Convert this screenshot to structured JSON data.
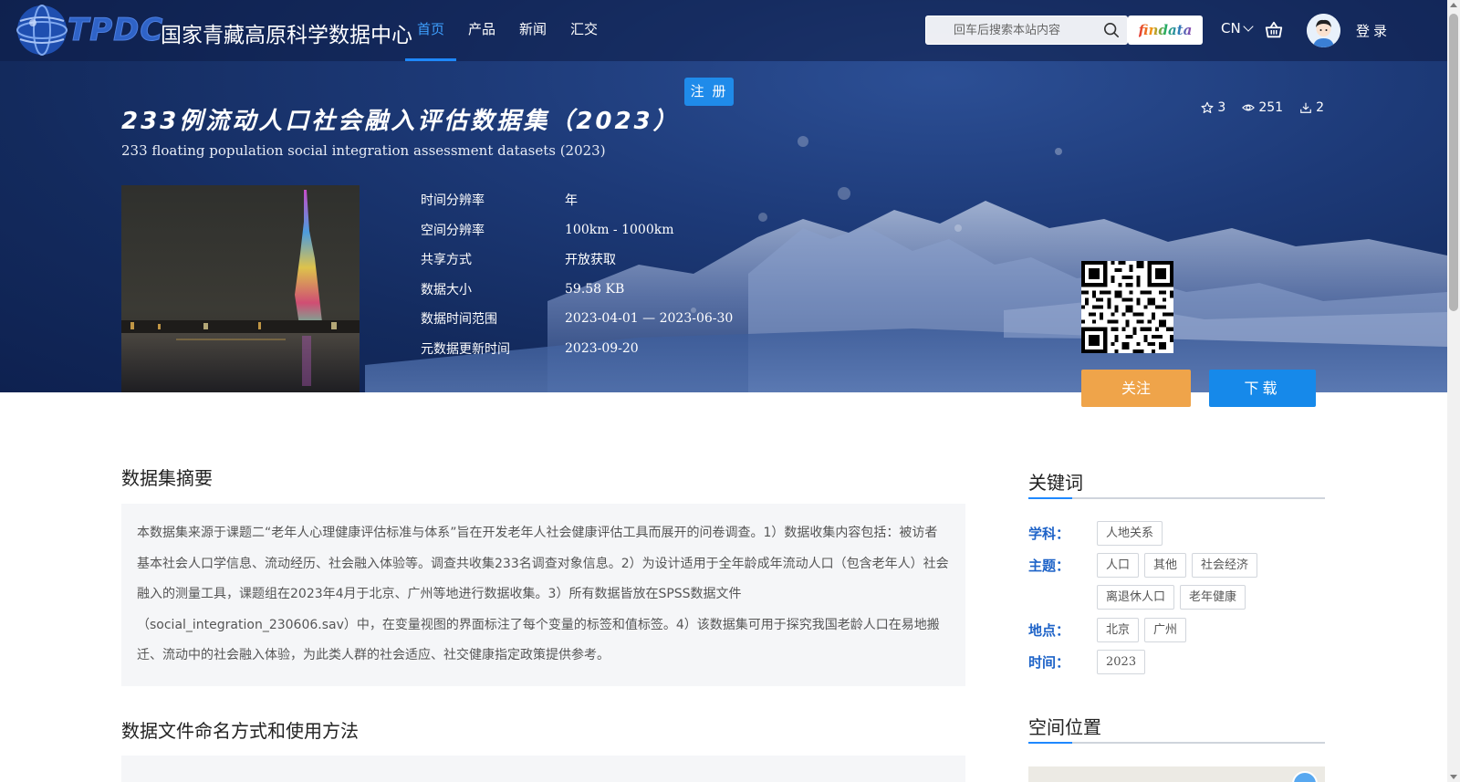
{
  "header": {
    "logo_abbr": "TPDC",
    "logo_name": "国家青藏高原科学数据中心",
    "nav": [
      {
        "label": "首页",
        "active": true
      },
      {
        "label": "产品",
        "active": false
      },
      {
        "label": "新闻",
        "active": false
      },
      {
        "label": "汇交",
        "active": false
      }
    ],
    "search_placeholder": "回车后搜索本站内容",
    "findata_label": "findata",
    "lang_label": "CN",
    "login_label": "登录",
    "icons": {
      "search": "search-icon",
      "cart": "cart-icon",
      "avatar": "avatar",
      "lang": "chevron-down-icon"
    }
  },
  "register_label": "注 册",
  "dataset": {
    "title_cn": "233例流动人口社会融入评估数据集（2023）",
    "title_en": "233 floating population social integration assessment datasets (2023)",
    "stats": {
      "stars": "3",
      "views": "251",
      "downloads": "2"
    },
    "meta": [
      {
        "label": "时间分辨率",
        "value": "年"
      },
      {
        "label": "空间分辨率",
        "value": "100km - 1000km"
      },
      {
        "label": "共享方式",
        "value": "开放获取"
      },
      {
        "label": "数据大小",
        "value": "59.58 KB"
      },
      {
        "label": "数据时间范围",
        "value": "2023-04-01 — 2023-06-30"
      },
      {
        "label": "元数据更新时间",
        "value": "2023-09-20"
      }
    ],
    "follow_label": "关注",
    "download_label": "下载"
  },
  "abstract": {
    "title": "数据集摘要",
    "text": "本数据集来源于课题二“老年人心理健康评估标准与体系”旨在开发老年人社会健康评估工具而展开的问卷调查。1）数据收集内容包括：被访者基本社会人口学信息、流动经历、社会融入体验等。调查共收集233名调查对象信息。2）为设计适用于全年龄成年流动人口（包含老年人）社会融入的测量工具，课题组在2023年4月于北京、广州等地进行数据收集。3）所有数据皆放在SPSS数据文件（social_integration_230606.sav）中，在变量视图的界面标注了每个变量的标签和值标签。4）该数据集可用于探究我国老龄人口在易地搬迁、流动中的社会融入体验，为此类人群的社会适应、社交健康指定政策提供参考。"
  },
  "file_section": {
    "title": "数据文件命名方式和使用方法"
  },
  "keywords": {
    "title": "关键词",
    "groups": [
      {
        "label": "学科：",
        "tags": [
          "人地关系"
        ]
      },
      {
        "label": "主题：",
        "tags": [
          "人口",
          "其他",
          "社会经济",
          "离退休人口",
          "老年健康"
        ]
      },
      {
        "label": "地点：",
        "tags": [
          "北京",
          "广州"
        ]
      },
      {
        "label": "时间：",
        "tags": [
          "2023"
        ]
      }
    ]
  },
  "spatial": {
    "title": "空间位置"
  },
  "colors": {
    "accent": "#1e88ff",
    "follow": "#efa44a",
    "download": "#1689ea",
    "keyword_label": "#1e63c8"
  }
}
